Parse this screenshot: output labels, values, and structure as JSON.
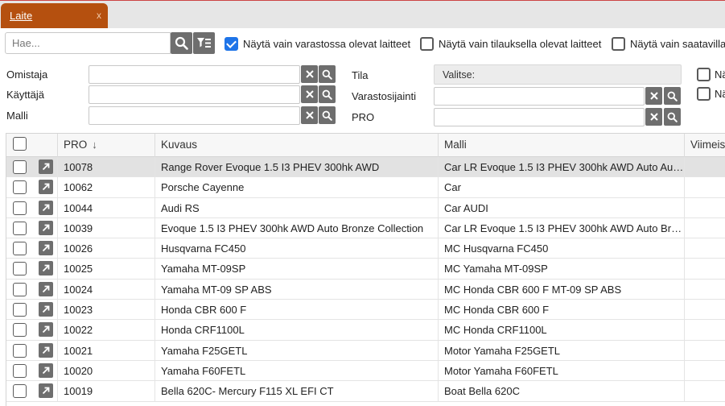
{
  "tab": {
    "label": "Laite",
    "close": "x"
  },
  "toolbar": {
    "search_placeholder": "Hae...",
    "options": [
      {
        "label": "Näytä vain varastossa olevat laitteet",
        "checked": true
      },
      {
        "label": "Näytä vain tilauksella olevat laitteet",
        "checked": false
      },
      {
        "label": "Näytä vain saatavilla o",
        "checked": false
      }
    ]
  },
  "filters": {
    "omistaja_label": "Omistaja",
    "kayttaja_label": "Käyttäjä",
    "malli_label": "Malli",
    "tila_label": "Tila",
    "tila_value": "Valitse:",
    "varastosijainti_label": "Varastosijainti",
    "pro_label": "PRO",
    "extra1_label": "Nä",
    "extra2_label": "Nä"
  },
  "table": {
    "headers": {
      "pro": "PRO",
      "sort": "↓",
      "kuvaus": "Kuvaus",
      "malli": "Malli",
      "viimeis": "Viimeis"
    },
    "rows": [
      {
        "pro": "10078",
        "kuvaus": "Range Rover Evoque 1.5 I3 PHEV 300hk AWD",
        "malli": "Car LR Evoque 1.5 I3 PHEV 300hk AWD Auto Aut..."
      },
      {
        "pro": "10062",
        "kuvaus": "Porsche Cayenne",
        "malli": "Car"
      },
      {
        "pro": "10044",
        "kuvaus": "Audi RS",
        "malli": "Car AUDI"
      },
      {
        "pro": "10039",
        "kuvaus": "Evoque 1.5 I3 PHEV 300hk AWD Auto Bronze Collection",
        "malli": "Car LR Evoque 1.5 I3 PHEV 300hk AWD Auto Bro..."
      },
      {
        "pro": "10026",
        "kuvaus": "Husqvarna FC450",
        "malli": "MC Husqvarna FC450"
      },
      {
        "pro": "10025",
        "kuvaus": "Yamaha MT-09SP",
        "malli": "MC Yamaha MT-09SP"
      },
      {
        "pro": "10024",
        "kuvaus": "Yamaha MT-09 SP ABS",
        "malli": "MC Honda CBR 600 F MT-09 SP ABS"
      },
      {
        "pro": "10023",
        "kuvaus": "Honda CBR 600 F",
        "malli": "MC Honda CBR 600 F"
      },
      {
        "pro": "10022",
        "kuvaus": "Honda CRF1100L",
        "malli": "MC Honda CRF1100L"
      },
      {
        "pro": "10021",
        "kuvaus": "Yamaha F25GETL",
        "malli": "Motor Yamaha F25GETL"
      },
      {
        "pro": "10020",
        "kuvaus": "Yamaha F60FETL",
        "malli": "Motor Yamaha F60FETL"
      },
      {
        "pro": "10019",
        "kuvaus": "Bella 620C- Mercury F115 XL EFI CT",
        "malli": "Boat Bella 620C"
      }
    ]
  }
}
